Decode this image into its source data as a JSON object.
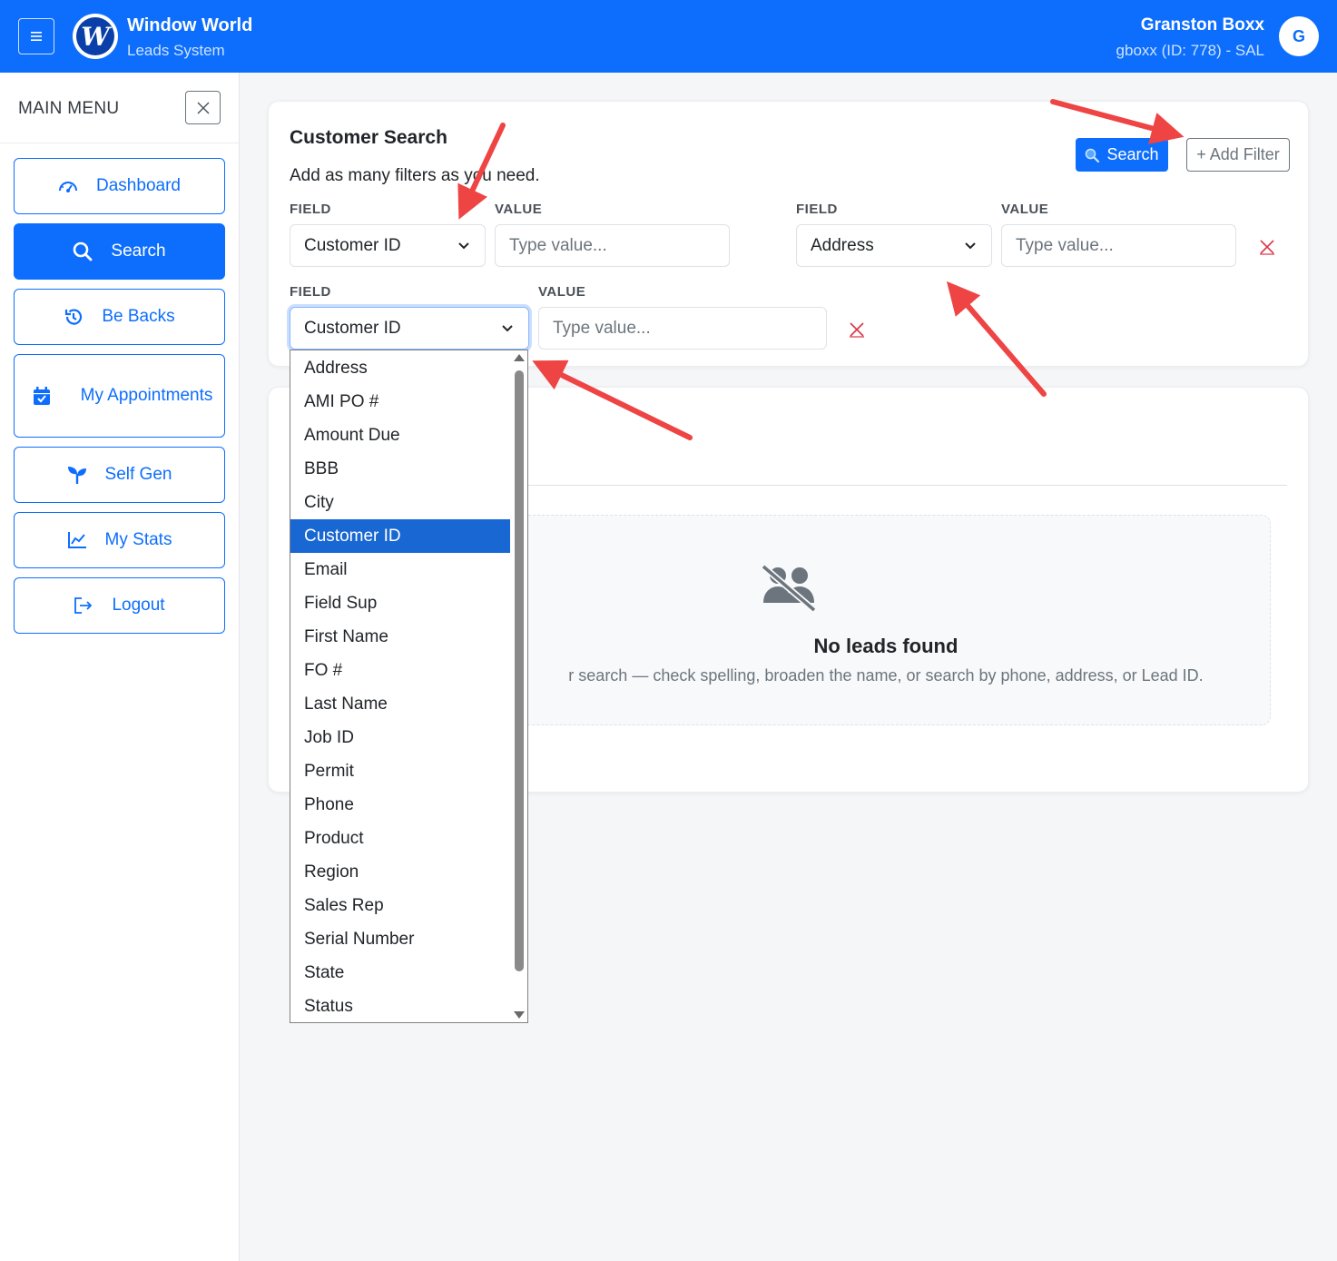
{
  "header": {
    "brand_title": "Window World",
    "brand_subtitle": "Leads System",
    "logo_letter": "W",
    "user_name": "Granston Boxx",
    "user_detail": "gboxx (ID: 778) - SAL",
    "avatar_initial": "G",
    "menu_icon": "hamburger-icon"
  },
  "sidebar": {
    "title": "MAIN MENU",
    "items": [
      {
        "label": "Dashboard",
        "icon": "gauge-icon",
        "active": false
      },
      {
        "label": "Search",
        "icon": "search-icon",
        "active": true
      },
      {
        "label": "Be Backs",
        "icon": "history-icon",
        "active": false
      },
      {
        "label": "My Appointments",
        "icon": "calendar-check-icon",
        "active": false
      },
      {
        "label": "Self Gen",
        "icon": "seedling-icon",
        "active": false
      },
      {
        "label": "My Stats",
        "icon": "line-chart-icon",
        "active": false
      },
      {
        "label": "Logout",
        "icon": "logout-icon",
        "active": false
      }
    ]
  },
  "search_card": {
    "title": "Customer Search",
    "subtitle": "Add as many filters as you need.",
    "search_button": "Search",
    "add_filter_button": "+ Add Filter",
    "field_label": "FIELD",
    "value_label": "VALUE",
    "filters": [
      {
        "field": "Customer ID",
        "placeholder": "Type value..."
      },
      {
        "field": "Address",
        "placeholder": "Type value..."
      },
      {
        "field": "Customer ID",
        "placeholder": "Type value..."
      }
    ]
  },
  "results": {
    "empty_title": "No leads found",
    "empty_text": "r search — check spelling, broaden the name, or search by phone, address, or Lead ID."
  },
  "field_dropdown": {
    "selected": "Customer ID",
    "options": [
      "Address",
      "AMI PO #",
      "Amount Due",
      "BBB",
      "City",
      "Customer ID",
      "Email",
      "Field Sup",
      "First Name",
      "FO #",
      "Last Name",
      "Job ID",
      "Permit",
      "Phone",
      "Product",
      "Region",
      "Sales Rep",
      "Serial Number",
      "State",
      "Status"
    ]
  },
  "colors": {
    "primary": "#0d6efd",
    "danger": "#dc3545",
    "annotation_arrow": "#ef4444",
    "dropdown_highlight": "#1967d2"
  }
}
